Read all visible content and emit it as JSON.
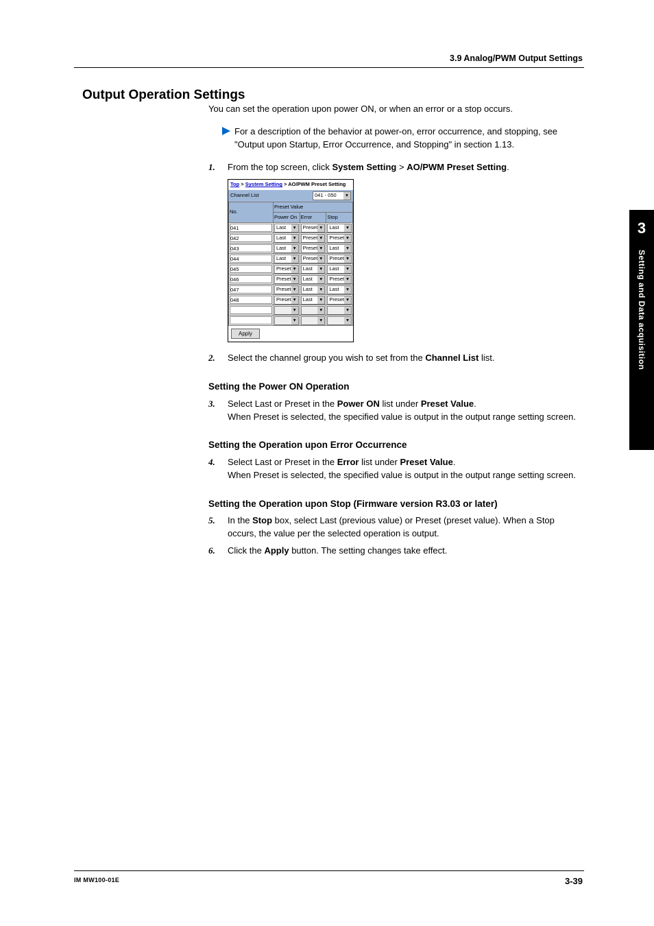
{
  "header": {
    "section_title": "3.9  Analog/PWM Output Settings"
  },
  "main": {
    "heading": "Output Operation Settings"
  },
  "intro": "You can set the operation upon power ON, or when an error or a stop occurs.",
  "note": "For a description of the behavior at power-on, error occurrence, and stopping, see \"Output upon Startup, Error Occurrence, and Stopping\" in section 1.13.",
  "step1": {
    "num": "1.",
    "pre": "From the top screen, click ",
    "b1": "System Setting",
    "mid": " > ",
    "b2": "AO/PWM Preset Setting",
    "post": "."
  },
  "screenshot": {
    "bc": {
      "top": "Top",
      "s1": " > ",
      "ss": "System Setting",
      "s2": " > AO/PWM Preset Setting"
    },
    "channel_list_label": "Channel List",
    "channel_range": "041 - 050",
    "headers": {
      "no": "No.",
      "preset": "Preset Value",
      "pon": "Power On",
      "err": "Error",
      "stop": "Stop"
    },
    "rows": [
      {
        "no": "041",
        "pon": "Last",
        "err": "Preset",
        "stop": "Last"
      },
      {
        "no": "042",
        "pon": "Last",
        "err": "Preset",
        "stop": "Preset"
      },
      {
        "no": "043",
        "pon": "Last",
        "err": "Preset",
        "stop": "Last"
      },
      {
        "no": "044",
        "pon": "Last",
        "err": "Preset",
        "stop": "Preset"
      },
      {
        "no": "045",
        "pon": "Preset",
        "err": "Last",
        "stop": "Last"
      },
      {
        "no": "046",
        "pon": "Preset",
        "err": "Last",
        "stop": "Preset"
      },
      {
        "no": "047",
        "pon": "Preset",
        "err": "Last",
        "stop": "Last"
      },
      {
        "no": "048",
        "pon": "Preset",
        "err": "Last",
        "stop": "Preset"
      }
    ],
    "apply": "Apply"
  },
  "step2": {
    "num": "2.",
    "pre": "Select the channel group you wish to set from the ",
    "b": "Channel List",
    "post": " list."
  },
  "sub_pon": {
    "title": "Setting the Power ON Operation",
    "num": "3.",
    "pre": "Select Last or Preset in the ",
    "b1": "Power ON",
    "mid": " list under ",
    "b2": "Preset Value",
    "post": ".",
    "line2": "When Preset is selected, the specified value is output in the output range setting screen."
  },
  "sub_err": {
    "title": "Setting the Operation upon Error Occurrence",
    "num": "4.",
    "pre": "Select Last or Preset in the ",
    "b1": "Error",
    "mid": " list under ",
    "b2": "Preset Value",
    "post": ".",
    "line2": "When Preset is selected, the specified value is output in the output range setting screen."
  },
  "sub_stop": {
    "title": "Setting the Operation upon Stop (Firmware version R3.03 or later)",
    "num5": "5.",
    "pre5a": "In the ",
    "b5": "Stop",
    "post5a": " box, select Last (previous value) or Preset (preset value). When a Stop occurs, the value per the selected operation is output.",
    "num6": "6.",
    "pre6": "Click the ",
    "b6": "Apply",
    "post6": " button. The setting changes take effect."
  },
  "sidetab": {
    "chapter": "3",
    "label": "Setting and Data acquisition"
  },
  "footer": {
    "left": "IM MW100-01E",
    "right": "3-39"
  }
}
